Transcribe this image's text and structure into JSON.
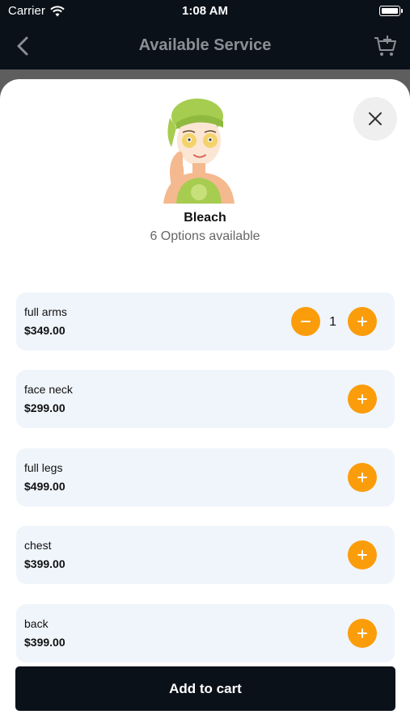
{
  "status_bar": {
    "carrier": "Carrier",
    "time": "1:08 AM"
  },
  "nav": {
    "title": "Available Service"
  },
  "service": {
    "name": "Bleach",
    "options_label": "6 Options available"
  },
  "options": [
    {
      "name": "full arms",
      "price": "$349.00",
      "quantity": "1"
    },
    {
      "name": "face neck",
      "price": "$299.00"
    },
    {
      "name": "full legs",
      "price": "$499.00"
    },
    {
      "name": "chest",
      "price": "$399.00"
    },
    {
      "name": "back",
      "price": "$399.00"
    }
  ],
  "cart": {
    "label": "Add to cart"
  },
  "colors": {
    "accent": "#fb9d0b",
    "dark": "#0b1119",
    "card": "#f0f5fb"
  }
}
